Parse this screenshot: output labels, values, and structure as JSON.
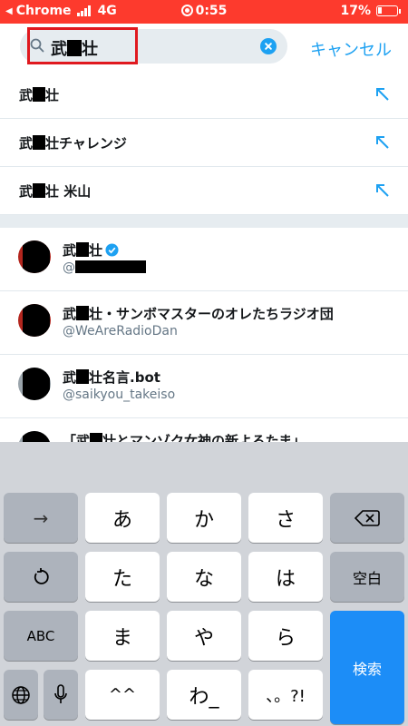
{
  "status_bar": {
    "back_label": "Chrome",
    "network": "4G",
    "time": "0:55",
    "battery": "17%"
  },
  "search": {
    "query_prefix": "武",
    "query_suffix": "壮",
    "cancel_label": "キャンセル"
  },
  "suggestions": [
    {
      "label": "武■壮",
      "prefix": "武",
      "suffix": "壮"
    },
    {
      "label": "武■壮チャレンジ",
      "prefix": "武",
      "suffix": "壮チャレンジ"
    },
    {
      "label": "武■壮 米山",
      "prefix": "武",
      "suffix": "壮 米山"
    }
  ],
  "accounts": [
    {
      "name_prefix": "武",
      "name_suffix": "壮",
      "verified": true,
      "handle": "@"
    },
    {
      "name_prefix": "武",
      "name_suffix": "壮・サンボマスターのオレたちラジオ団",
      "verified": false,
      "handle": "@WeAreRadioDan"
    },
    {
      "name_prefix": "武",
      "name_suffix": "壮名言.bot",
      "verified": false,
      "handle": "@saikyou_takeiso"
    },
    {
      "name_prefix": "「武",
      "name_suffix": "壮とマンゾク女神の新よるたま」",
      "verified": false,
      "handle": ""
    }
  ],
  "keyboard": {
    "row1": [
      "→",
      "あ",
      "か",
      "さ",
      "delete"
    ],
    "row2": [
      "undo",
      "た",
      "な",
      "は",
      "空白"
    ],
    "row3": [
      "ABC",
      "ま",
      "や",
      "ら",
      "検索"
    ],
    "row4": [
      "globe",
      "mic",
      "^^",
      "わ_",
      "、。?!"
    ]
  },
  "colors": {
    "status_bar": "#fd3a2d",
    "accent": "#1da1f2",
    "highlight": "#e0191f",
    "search_key": "#1c8df7"
  }
}
